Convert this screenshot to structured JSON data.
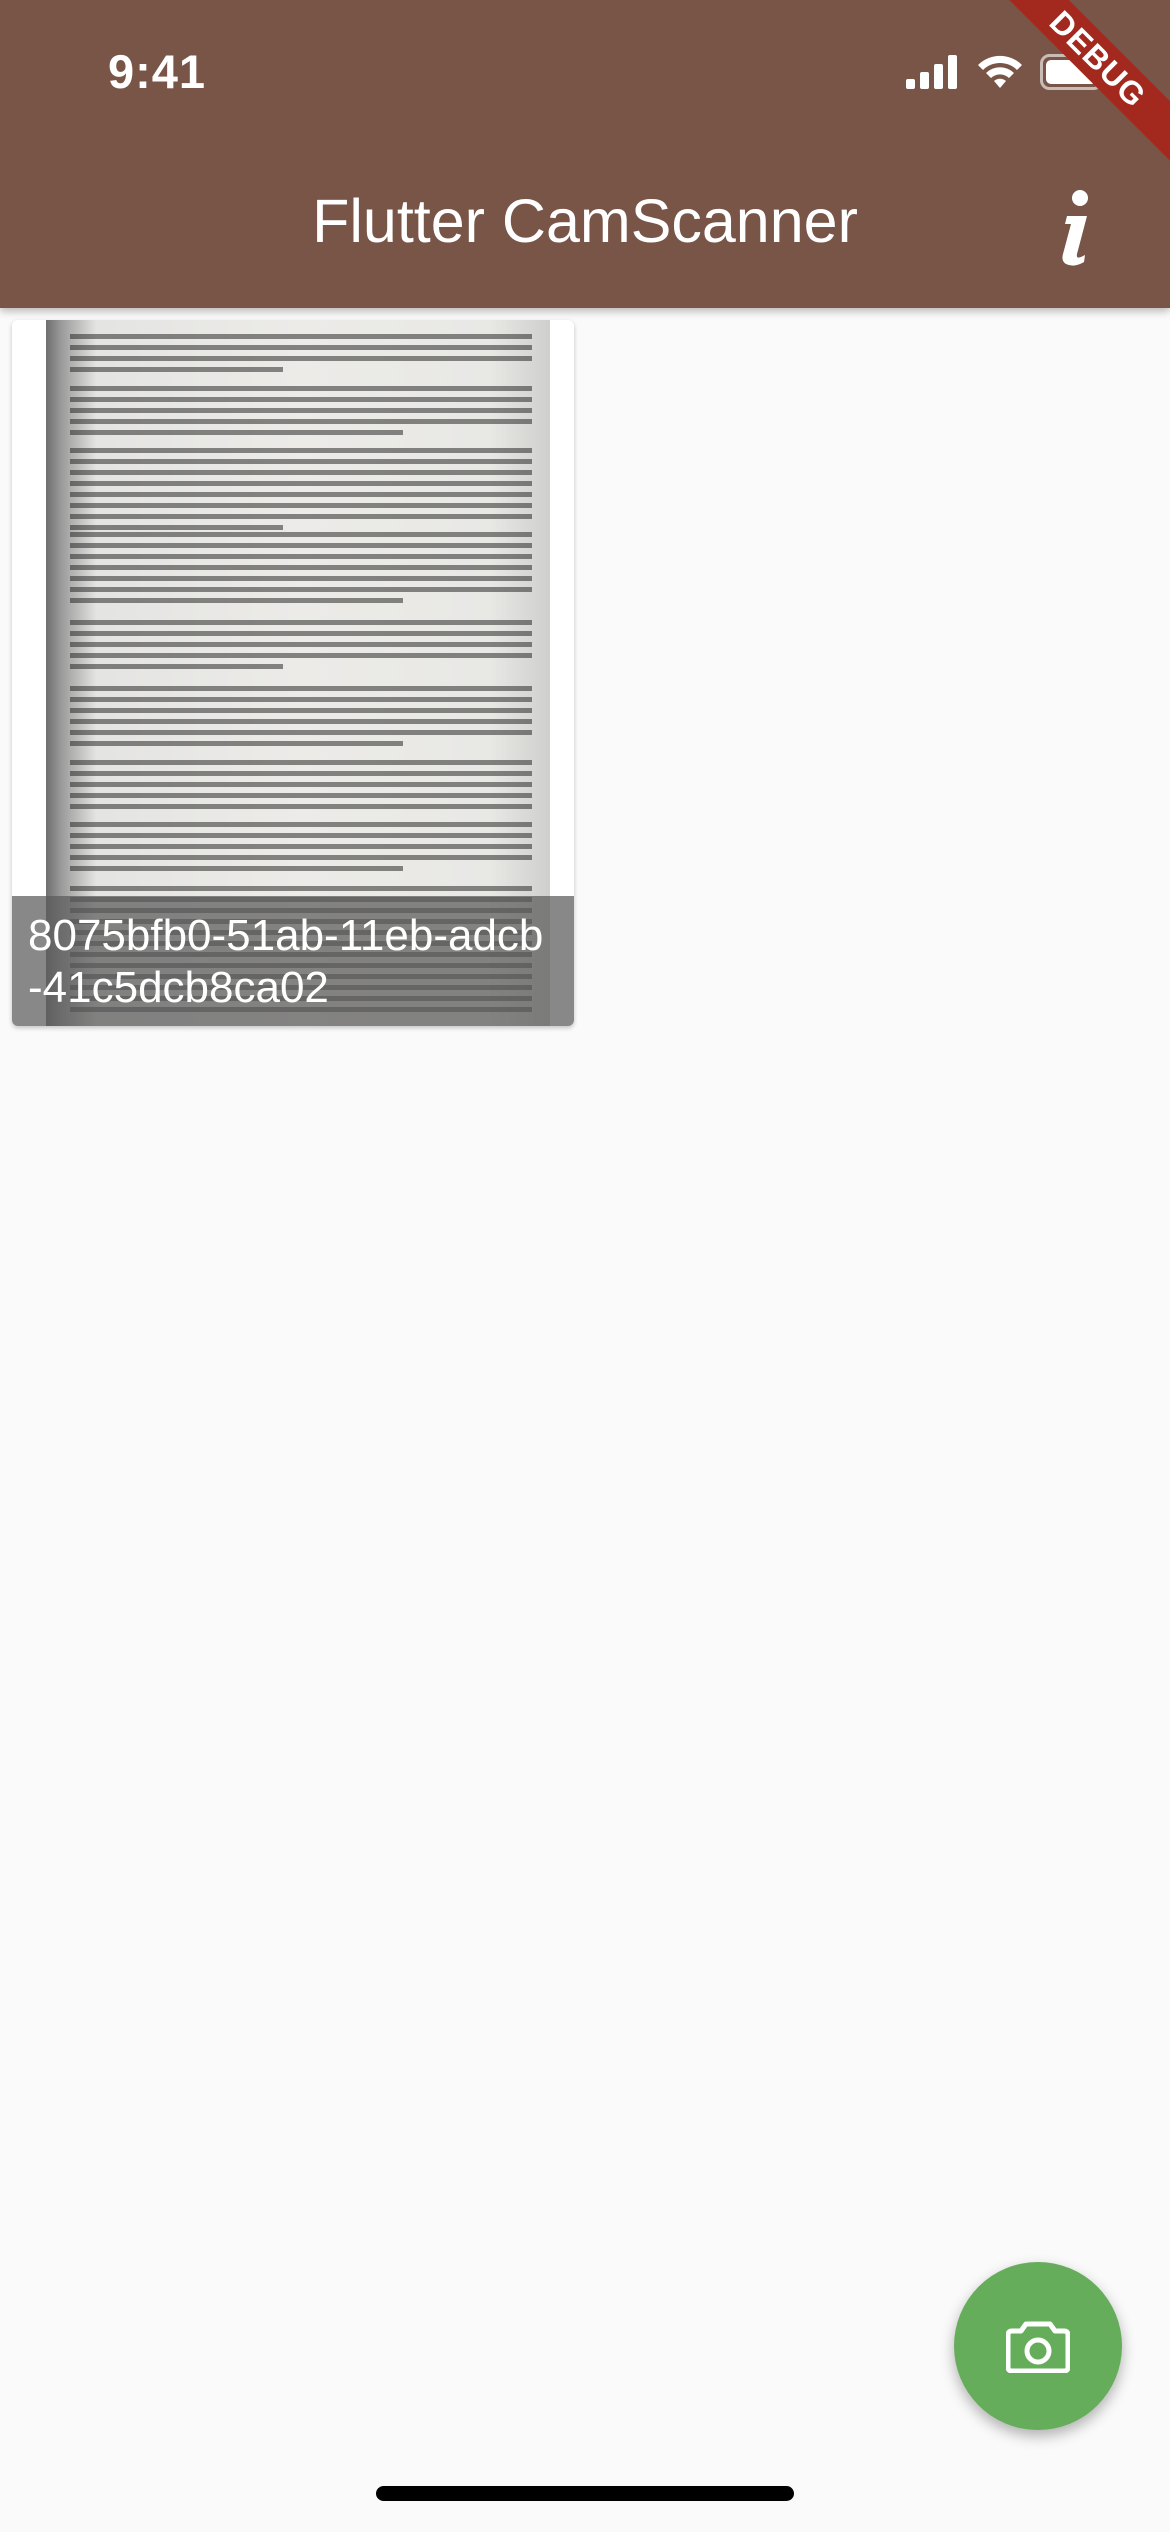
{
  "status_bar": {
    "time": "9:41"
  },
  "app_bar": {
    "title": "Flutter CamScanner",
    "debug_banner": "DEBUG",
    "info_icon": "info-icon",
    "color": "#795548"
  },
  "scans": [
    {
      "name": "8075bfb0-51ab-11eb-adcb-41c5dcb8ca02"
    }
  ],
  "fab": {
    "icon": "camera-icon",
    "color": "#66ad5b"
  }
}
